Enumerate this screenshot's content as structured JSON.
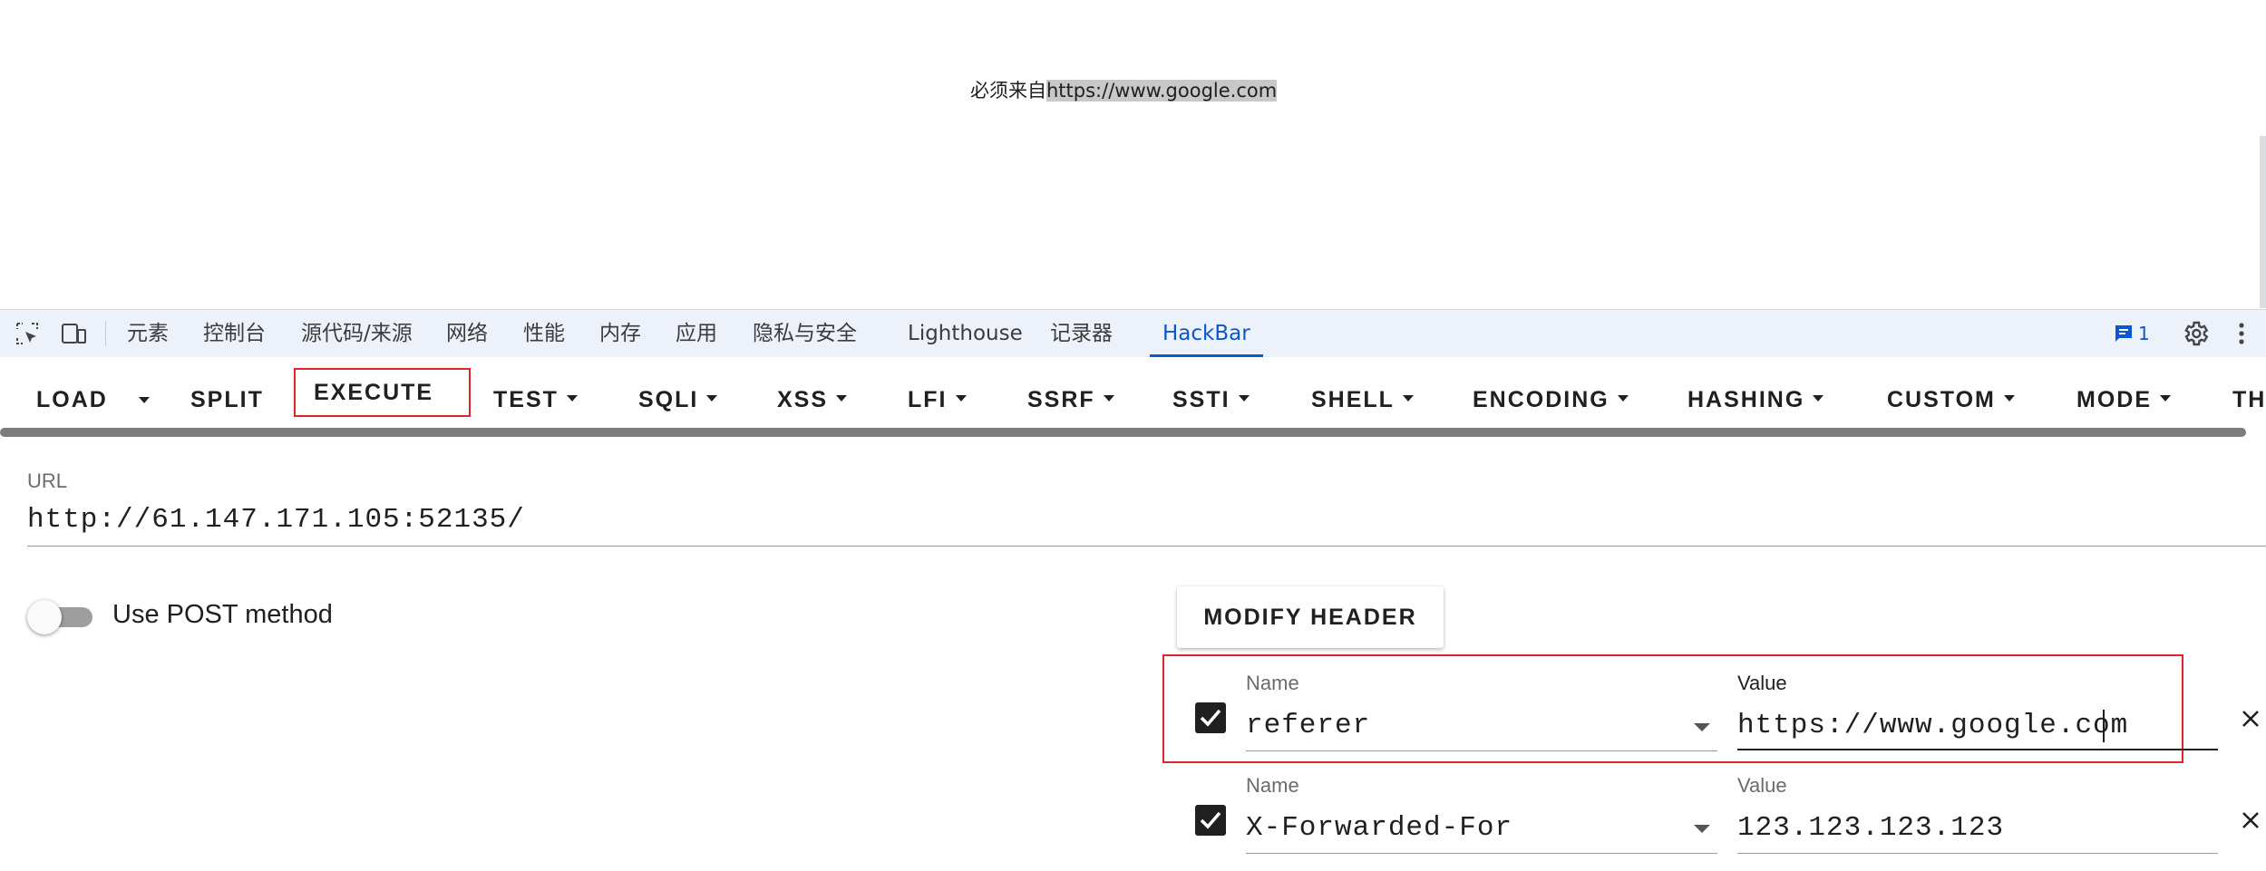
{
  "page": {
    "message_prefix": "必须来自",
    "message_highlight": "https://www.google.com"
  },
  "devtools": {
    "tabs": [
      "元素",
      "控制台",
      "源代码/来源",
      "网络",
      "性能",
      "内存",
      "应用",
      "隐私与安全",
      "Lighthouse",
      "记录器",
      "HackBar"
    ],
    "active_tab": "HackBar",
    "issues_count": "1",
    "icons": [
      "inspect-element-icon",
      "device-toolbar-icon",
      "issues-icon",
      "gear-icon",
      "more-vert-icon"
    ],
    "accent_color": "#0b57d0"
  },
  "hackbar": {
    "toolbar": {
      "load": "LOAD",
      "split": "SPLIT",
      "execute": "EXECUTE",
      "menus": [
        "TEST",
        "SQLI",
        "XSS",
        "LFI",
        "SSRF",
        "SSTI",
        "SHELL",
        "ENCODING",
        "HASHING",
        "CUSTOM",
        "MODE"
      ],
      "overflow": "TH"
    },
    "url": {
      "label": "URL",
      "value": "http://61.147.171.105:52135/"
    },
    "post": {
      "label": "Use POST method",
      "enabled": false
    },
    "modify_header_label": "MODIFY HEADER",
    "headers": [
      {
        "name_label": "Name",
        "name": "referer",
        "value_label": "Value",
        "value": "https://www.google.com",
        "checked": true
      },
      {
        "name_label": "Name",
        "name": "X-Forwarded-For",
        "value_label": "Value",
        "value": "123.123.123.123",
        "checked": true
      }
    ],
    "highlight_color": "#e0242a"
  }
}
